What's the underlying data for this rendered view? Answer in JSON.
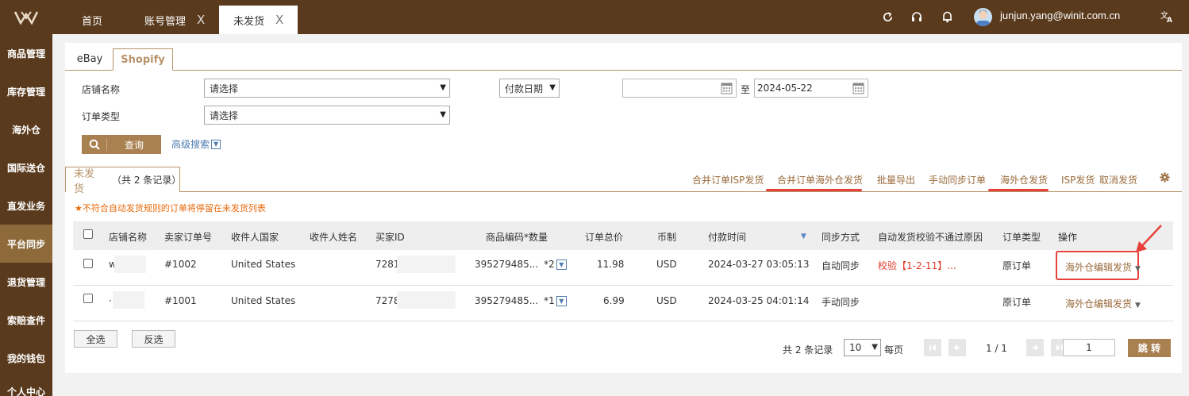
{
  "topbar": {
    "tabs": [
      {
        "label": "首页",
        "closable": false
      },
      {
        "label": "账号管理",
        "closable": true
      },
      {
        "label": "未发货",
        "closable": true,
        "active": true
      }
    ],
    "close_glyph": "X",
    "user": "junjun.yang@winit.com.cn",
    "icons": [
      "refresh-icon",
      "headset-icon",
      "bell-icon",
      "avatar",
      "translate-icon"
    ]
  },
  "sidebar": {
    "items": [
      "商品管理",
      "库存管理",
      "海外仓",
      "国际送仓",
      "直发业务",
      "平台同步",
      "退货管理",
      "索赔查件",
      "我的钱包",
      "个人中心"
    ],
    "active_index": 5
  },
  "platform_tabs": [
    "eBay",
    "Shopify"
  ],
  "filters": {
    "store_label": "店铺名称",
    "store_value": "请选择",
    "date_type": "付款日期",
    "date_from": "",
    "date_sep": "至",
    "date_to": "2024-05-22",
    "order_type_label": "订单类型",
    "order_type_value": "请选择",
    "query_label": "查询",
    "advanced_label": "高级搜索"
  },
  "subtab": {
    "label": "未发货",
    "count": "（共 2 条记录）"
  },
  "actions": [
    "合并订单ISP发货",
    "合并订单海外仓发货",
    "批量导出",
    "手动同步订单",
    "海外仓发货",
    "ISP发货",
    "取消发货"
  ],
  "notice": "不符合自动发货规则的订单将停留在未发货列表",
  "table": {
    "headers": [
      "店铺名称",
      "卖家订单号",
      "收件人国家",
      "收件人姓名",
      "买家ID",
      "商品编码*数量",
      "订单总价",
      "币制",
      "付款时间",
      "同步方式",
      "自动发货校验不通过原因",
      "订单类型",
      "操作"
    ],
    "rows": [
      {
        "store": "w",
        "order": "#1002",
        "country": "United States",
        "name": "",
        "buyer": "7281",
        "sku": "395279485...",
        "qty": "*2",
        "total": "11.98",
        "currency": "USD",
        "paid": "2024-03-27 03:05:13",
        "sync": "自动同步",
        "reason": "校验【1-2-11】...",
        "type": "原订单",
        "op": "海外仓编辑发货"
      },
      {
        "store": "·",
        "order": "#1001",
        "country": "United States",
        "name": "",
        "buyer": "7278",
        "sku": "395279485...",
        "qty": "*1",
        "total": "6.99",
        "currency": "USD",
        "paid": "2024-03-25 04:01:14",
        "sync": "手动同步",
        "reason": "",
        "type": "原订单",
        "op": "海外仓编辑发货"
      }
    ]
  },
  "footer": {
    "select_all": "全选",
    "invert": "反选",
    "total": "共 2 条记录",
    "page_size": "10",
    "per_page": "每页",
    "page_info": "1 / 1",
    "page_input": "1",
    "jump": "跳 转"
  },
  "colors": {
    "brand": "#5a3a1d",
    "accent": "#a98050",
    "highlight": "#e8403a"
  }
}
